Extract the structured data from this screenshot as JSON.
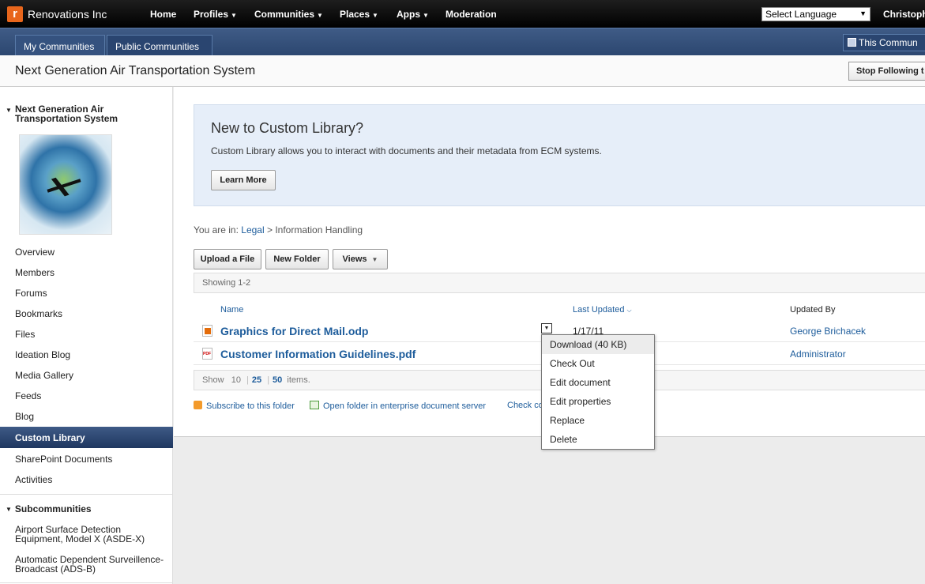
{
  "topbar": {
    "brand": "Renovations Inc",
    "logo_letter": "r",
    "nav": [
      "Home",
      "Profiles",
      "Communities",
      "Places",
      "Apps",
      "Moderation"
    ],
    "language": "Select Language",
    "user": "Christoph"
  },
  "tabs": {
    "my": "My Communities",
    "public": "Public Communities",
    "this": "This Commun"
  },
  "title": {
    "text": "Next Generation Air Transportation System",
    "stop_following": "Stop Following t"
  },
  "sidebar": {
    "community": "Next Generation Air Transportation System",
    "links": [
      "Overview",
      "Members",
      "Forums",
      "Bookmarks",
      "Files",
      "Ideation Blog",
      "Media Gallery",
      "Feeds",
      "Blog"
    ],
    "active": "Custom Library",
    "links_after": [
      "SharePoint Documents",
      "Activities"
    ],
    "subcommunities_heading": "Subcommunities",
    "subcommunities": [
      "Airport Surface Detection Equipment, Model X (ASDE-X)",
      "Automatic Dependent Surveillence-Broadcast (ADS-B)"
    ]
  },
  "promo": {
    "title": "New to Custom Library?",
    "desc": "Custom Library allows you to interact with documents and their metadata from ECM systems.",
    "learn_more": "Learn More"
  },
  "breadcrumb": {
    "prefix": "You are in:",
    "link": "Legal",
    "current": "> Information Handling"
  },
  "toolbar": {
    "upload": "Upload a File",
    "new_folder": "New Folder",
    "views": "Views"
  },
  "listing": {
    "showing": "Showing 1-2",
    "col_name": "Name",
    "col_updated": "Last Updated",
    "col_by": "Updated By",
    "files": [
      {
        "name": "Graphics for Direct Mail.odp",
        "date": "1/17/11",
        "by": "George Brichacek"
      },
      {
        "name": "Customer Information Guidelines.pdf",
        "date": "",
        "by": "Administrator"
      }
    ]
  },
  "pager": {
    "show": "Show",
    "opt10": "10",
    "opt25": "25",
    "opt50": "50",
    "items": "items."
  },
  "footer": {
    "subscribe": "Subscribe to this folder",
    "open_folder": "Open folder in enterprise document server",
    "check": "Check co"
  },
  "context_menu": {
    "items": [
      "Download (40 KB)",
      "Check Out",
      "Edit document",
      "Edit properties",
      "Replace",
      "Delete"
    ]
  }
}
